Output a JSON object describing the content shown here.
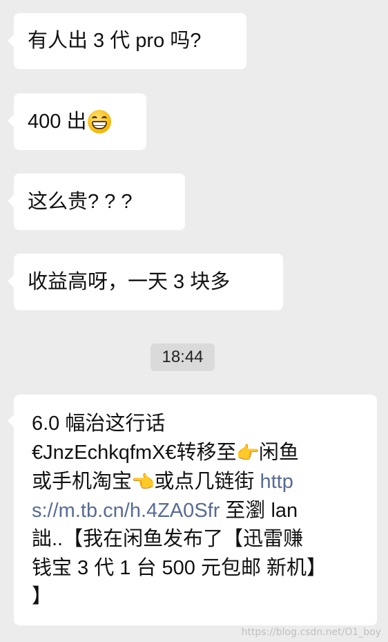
{
  "messages": [
    {
      "text": "有人出 3 代 pro 吗?"
    },
    {
      "text": "400 出",
      "emoji": "grinning-face-icon"
    },
    {
      "text": "这么贵? ? ?"
    },
    {
      "text": "收益高呀，一天 3 块多"
    }
  ],
  "timestamp": "18:44",
  "last_message": {
    "line1": "6.0 幅治这行话",
    "line2_a": "€JnzEchkqfmX€转移至",
    "line2_icon": "pointing-right-hand-icon",
    "line2_b": "闲鱼",
    "line3_a": "或手机淘宝",
    "line3_icon": "pointing-left-hand-icon",
    "line3_b": "或点几链街 ",
    "line3_link": "http",
    "line4_link": "s://m.tb.cn/h.4ZA0Sfr",
    "line4_b": " 至瀏 lan",
    "line5": "詘..【我在闲鱼发布了【迅雷赚",
    "line6": "钱宝 3 代 1 台 500 元包邮 新机】",
    "line7": "】"
  },
  "watermark": "https://blog.csdn.net/O1_boy",
  "colors": {
    "background": "#ececec",
    "bubble": "#ffffff",
    "link": "#576b95",
    "timestamp_bg": "#dadada"
  }
}
